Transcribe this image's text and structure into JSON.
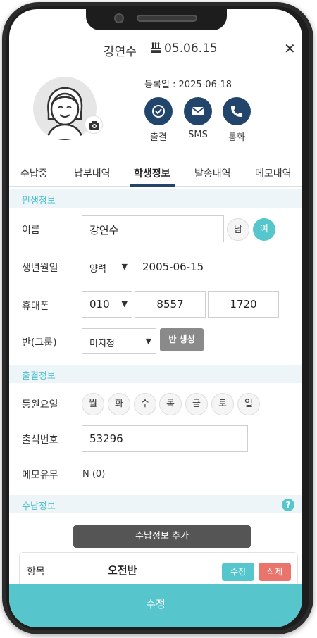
{
  "header": {
    "student_name": "강연수",
    "birthday": "05.06.15",
    "close_symbol": "✕"
  },
  "profile": {
    "registered_label": "등록일 : 2025-06-18",
    "actions": [
      {
        "label": "출결",
        "icon": "check-icon"
      },
      {
        "label": "SMS",
        "icon": "mail-icon"
      },
      {
        "label": "통화",
        "icon": "phone-icon"
      }
    ]
  },
  "tabs": [
    {
      "label": "수납중"
    },
    {
      "label": "납부내역"
    },
    {
      "label": "학생정보",
      "active": true
    },
    {
      "label": "발송내역"
    },
    {
      "label": "메모내역"
    }
  ],
  "student_section": {
    "title": "원생정보",
    "name_label": "이름",
    "name_value": "강연수",
    "gender_male": "남",
    "gender_female": "여",
    "birth_label": "생년월일",
    "calendar_type": "양력",
    "birth_value": "2005-06-15",
    "phone_label": "휴대폰",
    "phone_prefix": "010",
    "phone_mid": "8557",
    "phone_last": "1720",
    "class_label": "반(그룹)",
    "class_value": "미지정",
    "create_class_button": "반 생성"
  },
  "attendance_section": {
    "title": "출결정보",
    "days_label": "등원요일",
    "days": [
      "월",
      "화",
      "수",
      "목",
      "금",
      "토",
      "일"
    ],
    "attendance_no_label": "출석번호",
    "attendance_no_value": "53296",
    "memo_label": "메모유무",
    "memo_value": "N (0)"
  },
  "payment_section": {
    "title": "수납정보",
    "help_symbol": "?",
    "add_button": "수납정보 추가",
    "item_key": "항목",
    "item_value": "오전반",
    "edit_button": "수정",
    "delete_button": "삭제"
  },
  "footer": {
    "submit_label": "수정"
  },
  "colors": {
    "primary_dark": "#22456b",
    "accent_teal": "#56c6cd",
    "delete_red": "#e8746b"
  }
}
